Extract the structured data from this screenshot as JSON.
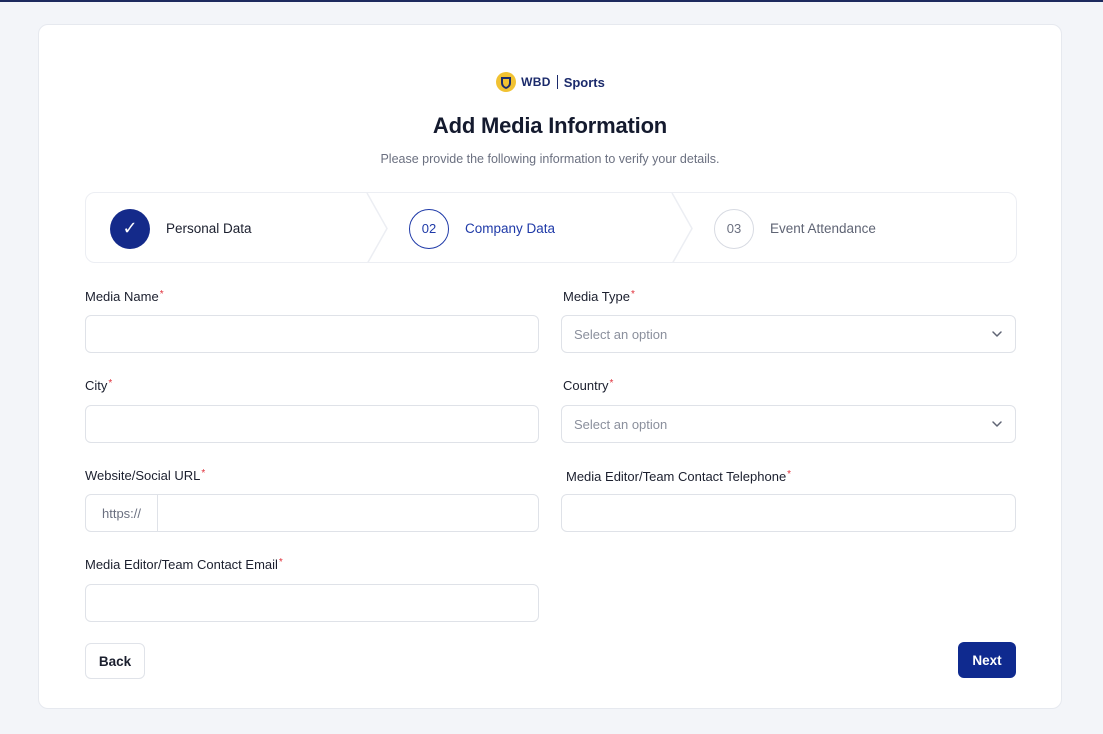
{
  "brand": {
    "wbd": "WBD",
    "sports": "Sports",
    "accent": "#0f2a8f"
  },
  "page": {
    "title": "Add Media Information",
    "subtitle": "Please provide the following information to verify your details."
  },
  "stepper": {
    "steps": [
      {
        "number": "✓",
        "label": "Personal Data",
        "state": "completed"
      },
      {
        "number": "02",
        "label": "Company Data",
        "state": "active"
      },
      {
        "number": "03",
        "label": "Event Attendance",
        "state": "pending"
      }
    ]
  },
  "form": {
    "required_marker": "*",
    "media_name": {
      "label": "Media Name",
      "value": ""
    },
    "media_type": {
      "label": "Media Type",
      "placeholder": "Select an option"
    },
    "city": {
      "label": "City",
      "value": ""
    },
    "country": {
      "label": "Country",
      "placeholder": "Select an option"
    },
    "website": {
      "label": "Website/Social URL",
      "prefix": "https://",
      "value": ""
    },
    "telephone": {
      "label": "Media Editor/Team Contact Telephone",
      "value": ""
    },
    "email": {
      "label": "Media Editor/Team Contact Email",
      "value": ""
    }
  },
  "actions": {
    "back_label": "Back",
    "next_label": "Next"
  }
}
